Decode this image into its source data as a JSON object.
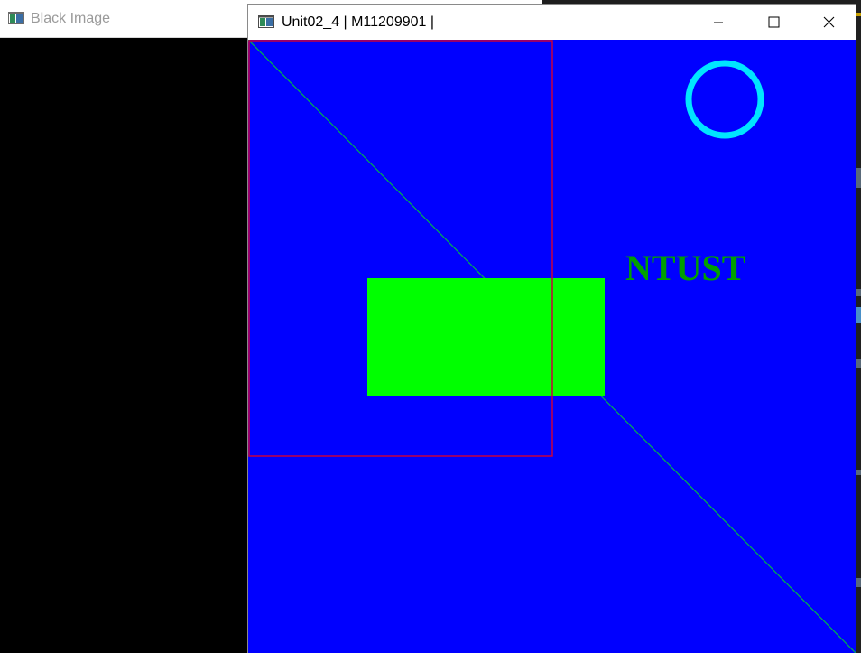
{
  "background_window": {
    "title": "Black Image",
    "icon": "opencv-window-icon"
  },
  "foreground_window": {
    "title": "Unit02_4 | M11209901 |",
    "icon": "opencv-window-icon",
    "controls": {
      "minimize": "minimize-icon",
      "maximize": "maximize-icon",
      "close": "close-icon"
    },
    "canvas": {
      "background_color": "#0000ff",
      "text_label": "NTUST",
      "text_color": "#00a000",
      "rectangle_outline_color": "#c8003c",
      "filled_rectangle_color": "#00ff00",
      "circle_color": "#00e5ff",
      "line_color": "#00b050"
    }
  }
}
